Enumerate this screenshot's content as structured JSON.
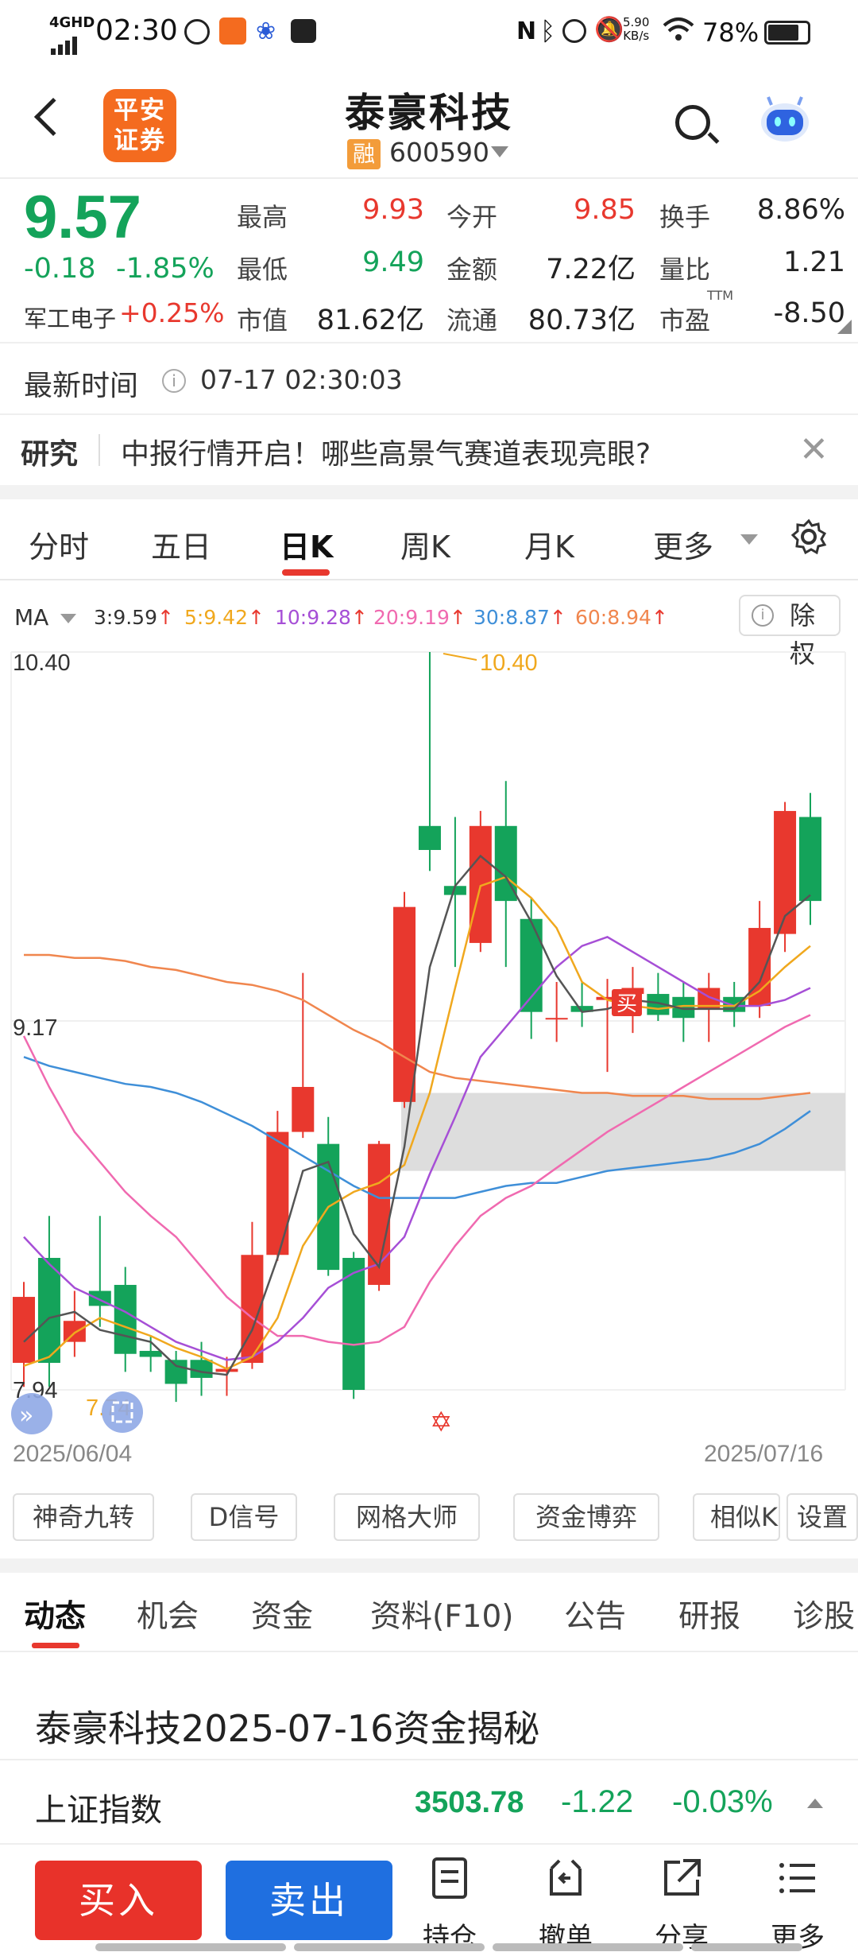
{
  "status_bar": {
    "network": "4GHD",
    "time": "02:30",
    "speed_value": "5.90",
    "speed_unit": "KB/s",
    "battery": "78%"
  },
  "header": {
    "stock_name": "泰豪科技",
    "rong_badge": "融",
    "stock_code": "600590",
    "broker_logo_line1": "平安",
    "broker_logo_line2": "证券"
  },
  "quote": {
    "price": "9.57",
    "change": "-0.18",
    "change_pct": "-1.85%",
    "sector_name": "军工电子",
    "sector_change": "+0.25%",
    "high_label": "最高",
    "high": "9.93",
    "open_label": "今开",
    "open": "9.85",
    "turnover_label": "换手",
    "turnover": "8.86%",
    "low_label": "最低",
    "low": "9.49",
    "amount_label": "金额",
    "amount": "7.22亿",
    "volume_ratio_label": "量比",
    "volume_ratio": "1.21",
    "mktcap_label": "市值",
    "mktcap": "81.62亿",
    "float_label": "流通",
    "float_cap": "80.73亿",
    "pe_label": "市盈",
    "pe_sup": "TTM",
    "pe": "-8.50"
  },
  "update": {
    "label": "最新时间",
    "time": "07-17 02:30:03"
  },
  "news": {
    "tag": "研究",
    "text": "中报行情开启！哪些高景气赛道表现亮眼?"
  },
  "period_tabs": [
    "分时",
    "五日",
    "日K",
    "周K",
    "月K",
    "更多"
  ],
  "ma": {
    "label": "MA",
    "items": [
      {
        "text": "3:9.59",
        "color": "#333333"
      },
      {
        "text": "5:9.42",
        "color": "#f0a81e"
      },
      {
        "text": "10:9.28",
        "color": "#a64fd6"
      },
      {
        "text": "20:9.19",
        "color": "#f06ab0"
      },
      {
        "text": "30:8.87",
        "color": "#3f8fd8"
      },
      {
        "text": "60:8.94",
        "color": "#f0864e"
      }
    ],
    "chuquan": "除权"
  },
  "chart_data": {
    "type": "candlestick",
    "y_top_label": "10.40",
    "y_mid_label": "9.17",
    "y_low_label": "7.94",
    "max_marker": "10.40",
    "min_marker": "7.74",
    "buy_marker": "买",
    "start_date": "2025/06/04",
    "end_date": "2025/07/16",
    "candles": [
      {
        "o": 8.03,
        "c": 8.25,
        "h": 8.3,
        "l": 7.95
      },
      {
        "o": 8.38,
        "c": 8.03,
        "h": 8.52,
        "l": 7.95
      },
      {
        "o": 8.1,
        "c": 8.17,
        "h": 8.27,
        "l": 8.05
      },
      {
        "o": 8.27,
        "c": 8.22,
        "h": 8.52,
        "l": 8.15
      },
      {
        "o": 8.29,
        "c": 8.06,
        "h": 8.35,
        "l": 8.0
      },
      {
        "o": 8.07,
        "c": 8.05,
        "h": 8.12,
        "l": 8.0
      },
      {
        "o": 8.04,
        "c": 7.96,
        "h": 8.07,
        "l": 7.9
      },
      {
        "o": 8.04,
        "c": 7.98,
        "h": 8.1,
        "l": 7.92
      },
      {
        "o": 8.0,
        "c": 8.01,
        "h": 8.05,
        "l": 7.92
      },
      {
        "o": 8.03,
        "c": 8.39,
        "h": 8.5,
        "l": 8.01
      },
      {
        "o": 8.39,
        "c": 8.8,
        "h": 8.87,
        "l": 8.37
      },
      {
        "o": 8.8,
        "c": 8.95,
        "h": 9.33,
        "l": 8.78
      },
      {
        "o": 8.76,
        "c": 8.34,
        "h": 8.85,
        "l": 8.32
      },
      {
        "o": 8.38,
        "c": 7.94,
        "h": 8.4,
        "l": 7.91
      },
      {
        "o": 8.29,
        "c": 8.76,
        "h": 8.77,
        "l": 8.27
      },
      {
        "o": 8.9,
        "c": 9.55,
        "h": 9.6,
        "l": 8.88
      },
      {
        "o": 9.82,
        "c": 9.74,
        "h": 10.4,
        "l": 9.67
      },
      {
        "o": 9.62,
        "c": 9.59,
        "h": 9.85,
        "l": 9.35
      },
      {
        "o": 9.43,
        "c": 9.82,
        "h": 9.87,
        "l": 9.4
      },
      {
        "o": 9.82,
        "c": 9.57,
        "h": 9.97,
        "l": 9.35
      },
      {
        "o": 9.51,
        "c": 9.2,
        "h": 9.58,
        "l": 9.11
      },
      {
        "o": 9.18,
        "c": 9.18,
        "h": 9.3,
        "l": 9.1
      },
      {
        "o": 9.22,
        "c": 9.2,
        "h": 9.3,
        "l": 9.15
      },
      {
        "o": 9.24,
        "c": 9.25,
        "h": 9.31,
        "l": 9.0
      },
      {
        "o": 9.26,
        "c": 9.28,
        "h": 9.35,
        "l": 9.13
      },
      {
        "o": 9.26,
        "c": 9.19,
        "h": 9.33,
        "l": 9.17
      },
      {
        "o": 9.25,
        "c": 9.18,
        "h": 9.3,
        "l": 9.1
      },
      {
        "o": 9.21,
        "c": 9.28,
        "h": 9.33,
        "l": 9.1
      },
      {
        "o": 9.25,
        "c": 9.2,
        "h": 9.3,
        "l": 9.15
      },
      {
        "o": 9.22,
        "c": 9.48,
        "h": 9.57,
        "l": 9.18
      },
      {
        "o": 9.46,
        "c": 9.87,
        "h": 9.9,
        "l": 9.4
      },
      {
        "o": 9.85,
        "c": 9.57,
        "h": 9.93,
        "l": 9.49
      }
    ],
    "ma3": [
      8.1,
      8.18,
      8.2,
      8.14,
      8.12,
      8.1,
      8.02,
      8.0,
      7.99,
      8.14,
      8.38,
      8.67,
      8.7,
      8.46,
      8.35,
      8.75,
      9.35,
      9.62,
      9.72,
      9.65,
      9.5,
      9.32,
      9.2,
      9.21,
      9.24,
      9.23,
      9.21,
      9.21,
      9.21,
      9.3,
      9.52,
      9.59
    ],
    "ma5": [
      8.02,
      8.05,
      8.13,
      8.18,
      8.15,
      8.12,
      8.08,
      8.05,
      8.01,
      8.05,
      8.18,
      8.42,
      8.55,
      8.6,
      8.63,
      8.69,
      8.93,
      9.28,
      9.62,
      9.65,
      9.58,
      9.48,
      9.3,
      9.24,
      9.22,
      9.21,
      9.22,
      9.22,
      9.22,
      9.27,
      9.35,
      9.42
    ],
    "ma10": [
      8.45,
      8.36,
      8.28,
      8.24,
      8.2,
      8.15,
      8.1,
      8.07,
      8.04,
      8.05,
      8.1,
      8.18,
      8.28,
      8.33,
      8.36,
      8.45,
      8.66,
      8.85,
      9.05,
      9.15,
      9.25,
      9.35,
      9.42,
      9.45,
      9.4,
      9.35,
      9.3,
      9.25,
      9.22,
      9.22,
      9.24,
      9.28
    ],
    "ma20": [
      9.12,
      8.95,
      8.8,
      8.7,
      8.6,
      8.52,
      8.45,
      8.35,
      8.25,
      8.18,
      8.12,
      8.12,
      8.1,
      8.09,
      8.1,
      8.15,
      8.3,
      8.42,
      8.52,
      8.58,
      8.62,
      8.68,
      8.74,
      8.8,
      8.85,
      8.9,
      8.95,
      9.0,
      9.05,
      9.1,
      9.15,
      9.19
    ],
    "ma30": [
      9.05,
      9.02,
      9.0,
      8.98,
      8.96,
      8.95,
      8.93,
      8.9,
      8.86,
      8.82,
      8.77,
      8.72,
      8.67,
      8.62,
      8.58,
      8.58,
      8.58,
      8.58,
      8.6,
      8.62,
      8.63,
      8.63,
      8.65,
      8.67,
      8.68,
      8.69,
      8.7,
      8.71,
      8.73,
      8.76,
      8.81,
      8.87
    ],
    "ma60": [
      9.39,
      9.39,
      9.38,
      9.38,
      9.37,
      9.35,
      9.34,
      9.32,
      9.3,
      9.29,
      9.27,
      9.24,
      9.19,
      9.14,
      9.1,
      9.05,
      9.0,
      8.98,
      8.97,
      8.96,
      8.95,
      8.94,
      8.93,
      8.93,
      8.92,
      8.92,
      8.92,
      8.91,
      8.91,
      8.91,
      8.92,
      8.93
    ],
    "ylim": [
      7.94,
      10.4
    ],
    "zone": [
      8.67,
      8.93
    ]
  },
  "indicator_buttons": [
    "神奇九转",
    "D信号",
    "网格大师",
    "资金博弈",
    "相似K线",
    "设置"
  ],
  "content_tabs": [
    "动态",
    "机会",
    "资金",
    "资料(F10)",
    "公告",
    "研报",
    "诊股"
  ],
  "article": {
    "title": "泰豪科技2025-07-16资金揭秘"
  },
  "index": {
    "name": "上证指数",
    "value": "3503.78",
    "change": "-1.22",
    "change_pct": "-0.03%"
  },
  "bottom_bar": {
    "buy": "买入",
    "sell": "卖出",
    "items": [
      "持仓",
      "撤单",
      "分享",
      "更多"
    ]
  },
  "colors": {
    "up": "#e8382e",
    "down": "#14a35a",
    "sell_blue": "#1f6fe0"
  }
}
